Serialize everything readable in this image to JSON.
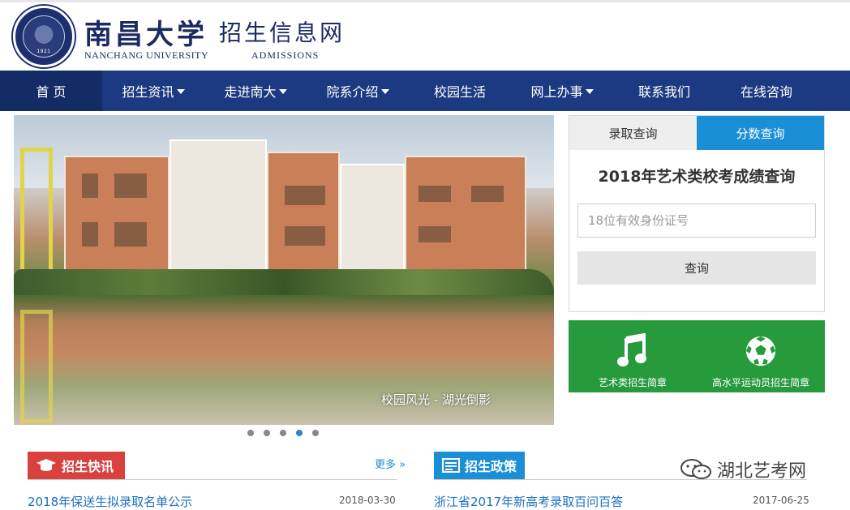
{
  "header": {
    "seal_year": "1921",
    "cn_name": "南昌大学",
    "en_name": "NANCHANG UNIVERSITY",
    "site_title": "招生信息网",
    "site_subtitle": "ADMISSIONS"
  },
  "nav": {
    "items": [
      {
        "label": "首 页",
        "dropdown": false
      },
      {
        "label": "招生资讯",
        "dropdown": true
      },
      {
        "label": "走进南大",
        "dropdown": true
      },
      {
        "label": "院系介绍",
        "dropdown": true
      },
      {
        "label": "校园生活",
        "dropdown": false
      },
      {
        "label": "网上办事",
        "dropdown": true
      },
      {
        "label": "联系我们",
        "dropdown": false
      },
      {
        "label": "在线咨询",
        "dropdown": false
      }
    ]
  },
  "banner": {
    "caption": "校园风光 - 湖光倒影",
    "slide_count": 5,
    "active_slide": 4
  },
  "query": {
    "tabs": [
      "录取查询",
      "分数查询"
    ],
    "active_tab": 1,
    "title": "2018年艺术类校考成绩查询",
    "input_placeholder": "18位有效身份证号",
    "submit_label": "查询"
  },
  "quick_links": [
    {
      "label": "艺术类招生简章",
      "icon": "music-note-icon"
    },
    {
      "label": "高水平运动员招生简章",
      "icon": "soccer-ball-icon"
    }
  ],
  "news": {
    "title": "招生快讯",
    "more": "更多 »",
    "first_item": {
      "title": "2018年保送生拟录取名单公示",
      "date": "2018-03-30"
    }
  },
  "policy": {
    "title": "招生政策",
    "first_item": {
      "title": "浙江省2017年新高考录取百问百答",
      "date": "2017-06-25"
    }
  },
  "watermark": "湖北艺考网",
  "colors": {
    "nav_bg": "#1c3a82",
    "accent_blue": "#1b8fd6",
    "news_red": "#d9413f",
    "green": "#279a3c"
  }
}
